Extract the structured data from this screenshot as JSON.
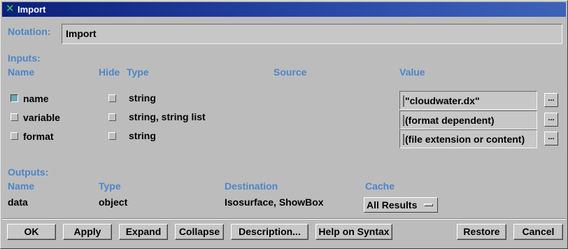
{
  "window": {
    "title": "Import"
  },
  "notation": {
    "label": "Notation:",
    "value": "Import"
  },
  "inputs": {
    "section_label": "Inputs:",
    "headers": {
      "name": "Name",
      "hide": "Hide",
      "type": "Type",
      "source": "Source",
      "value": "Value"
    },
    "rows": [
      {
        "name": "name",
        "name_checked": true,
        "type": "string",
        "hide_checked": false,
        "value": "\"cloudwater.dx\"",
        "browse": "..."
      },
      {
        "name": "variable",
        "name_checked": false,
        "type": "string, string list",
        "hide_checked": false,
        "value": "(format dependent)",
        "browse": "..."
      },
      {
        "name": "format",
        "name_checked": false,
        "type": "string",
        "hide_checked": false,
        "value": "(file extension or content)",
        "browse": "..."
      }
    ]
  },
  "outputs": {
    "section_label": "Outputs:",
    "headers": {
      "name": "Name",
      "type": "Type",
      "destination": "Destination",
      "cache": "Cache"
    },
    "rows": [
      {
        "name": "data",
        "type": "object",
        "destination": "Isosurface, ShowBox",
        "cache": "All Results"
      }
    ]
  },
  "buttons": {
    "ok": "OK",
    "apply": "Apply",
    "expand": "Expand",
    "collapse": "Collapse",
    "description": "Description...",
    "help": "Help on Syntax",
    "restore": "Restore",
    "cancel": "Cancel"
  },
  "colors": {
    "label_blue": "#4d86c8",
    "titlebar": "#0a1f7a",
    "checked": "#6aa8b8"
  }
}
